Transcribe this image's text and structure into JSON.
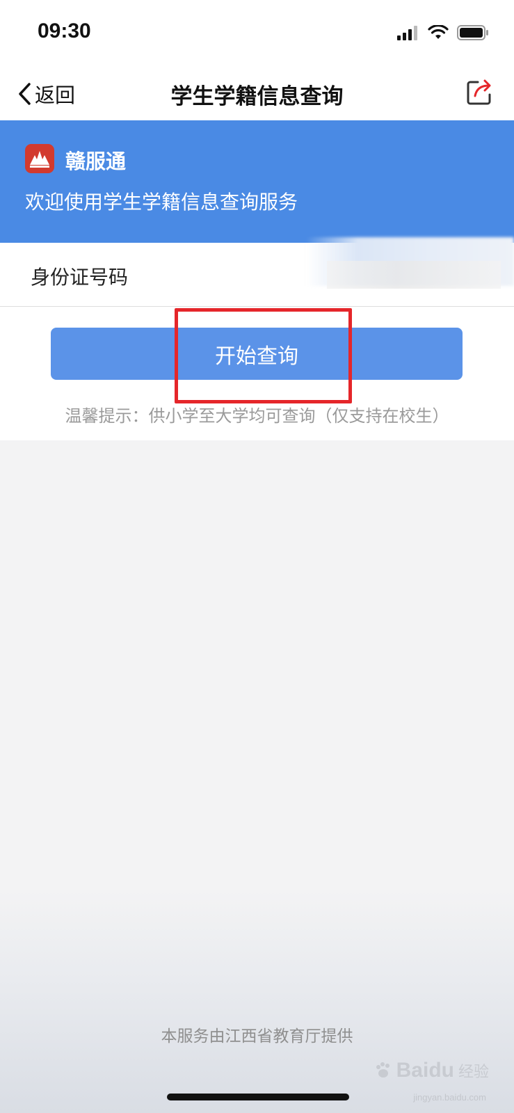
{
  "status_bar": {
    "time": "09:30"
  },
  "nav": {
    "back_label": "返回",
    "title": "学生学籍信息查询"
  },
  "banner": {
    "brand": "赣服通",
    "welcome": "欢迎使用学生学籍信息查询服务"
  },
  "form": {
    "id_label": "身份证号码",
    "submit_label": "开始查询",
    "tip": "温馨提示：供小学至大学均可查询（仅支持在校生）"
  },
  "footer": {
    "provider": "本服务由江西省教育厅提供"
  },
  "watermark": {
    "main": "Baidu",
    "sub": "经验",
    "url": "jingyan.baidu.com"
  },
  "colors": {
    "banner": "#4a8ae4",
    "button": "#5b93e8",
    "highlight": "#e5262a",
    "logo": "#d23a2e"
  }
}
